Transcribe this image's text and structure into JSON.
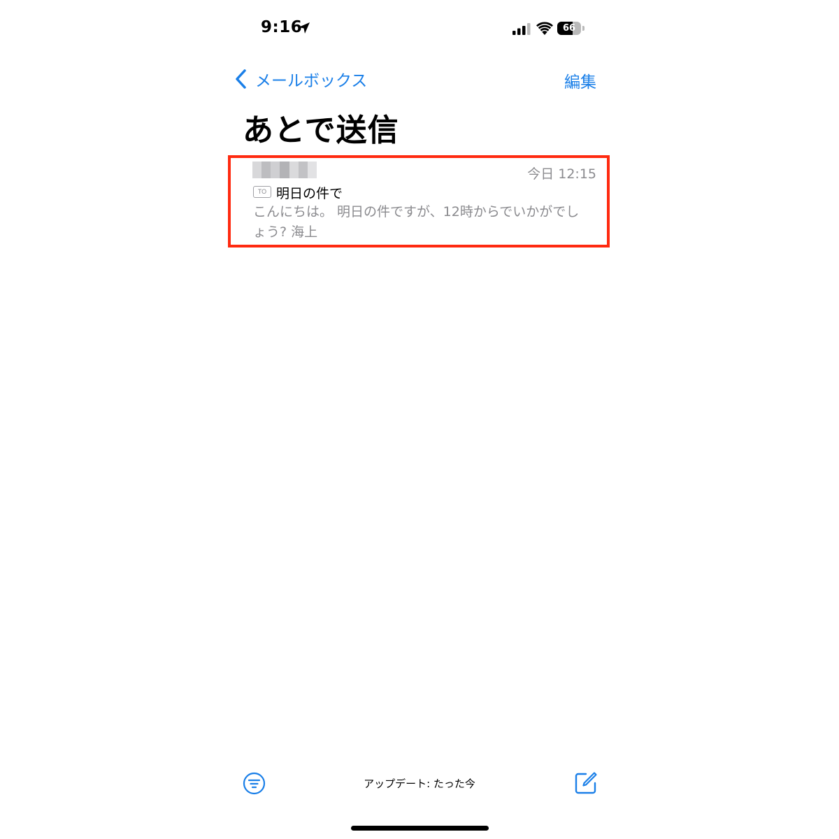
{
  "status_bar": {
    "time": "9:16",
    "battery_level": "66",
    "battery_fraction": 0.66
  },
  "nav": {
    "back_label": "メールボックス",
    "edit_label": "編集"
  },
  "page": {
    "title": "あとで送信"
  },
  "message": {
    "date": "今日 12:15",
    "to_badge": "TO",
    "subject": "明日の件で",
    "preview": "こんにちは。 明日の件ですが、12時からでいかがでしょう? 海上"
  },
  "toolbar": {
    "update_status": "アップデート: たった今"
  },
  "icons": {
    "location": "location-arrow-icon",
    "signal": "cellular-signal-icon",
    "wifi": "wifi-icon",
    "back": "chevron-left-icon",
    "filter": "filter-icon",
    "compose": "compose-icon"
  },
  "colors": {
    "accent": "#1a7fe8",
    "highlight": "#ff2a10",
    "secondary_text": "#8a8a8e"
  }
}
